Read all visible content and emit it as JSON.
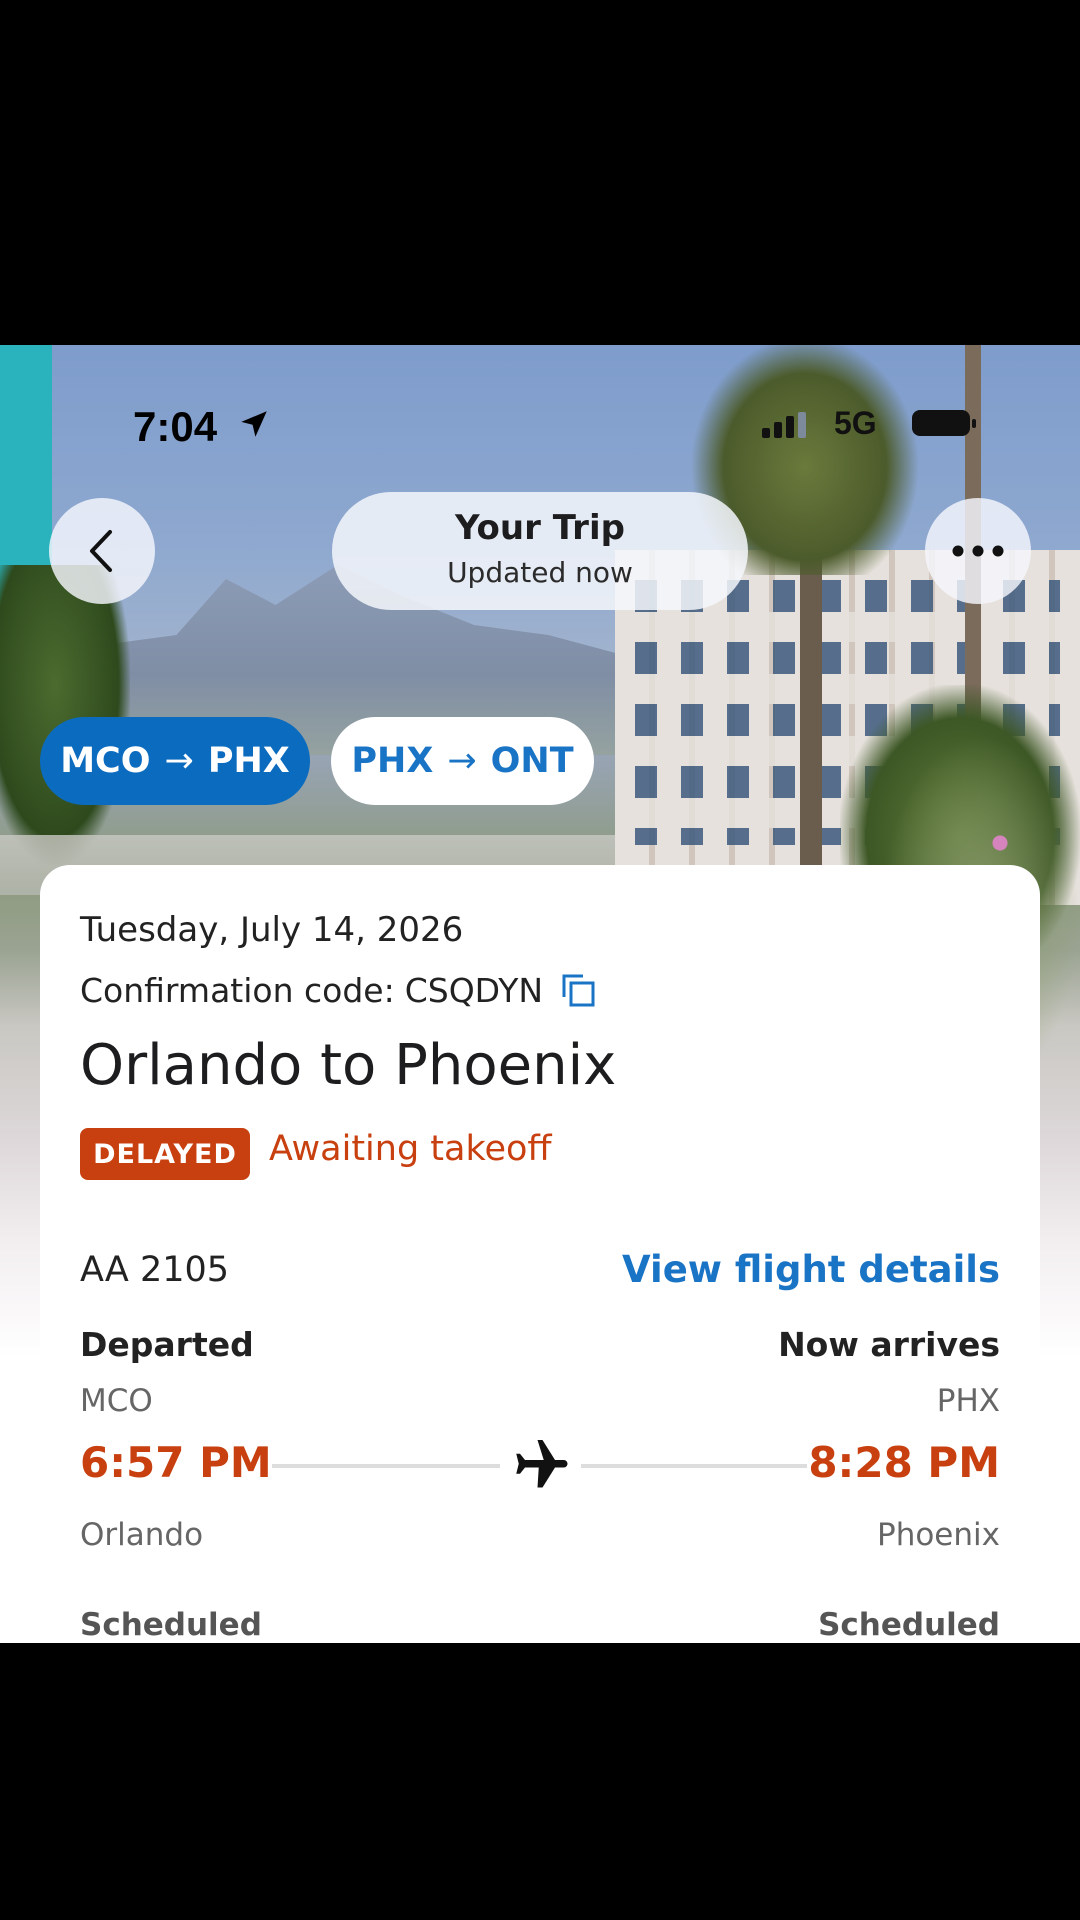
{
  "status_bar": {
    "time": "7:04",
    "network": "5G"
  },
  "header": {
    "title": "Your Trip",
    "subtitle": "Updated now"
  },
  "segments": [
    {
      "from": "MCO",
      "to": "PHX",
      "arrow": "→",
      "active": true
    },
    {
      "from": "PHX",
      "to": "ONT",
      "arrow": "→",
      "active": false
    }
  ],
  "trip": {
    "date": "Tuesday, July 14, 2026",
    "confirmation_label": "Confirmation code:",
    "confirmation_code": "CSQDYN",
    "route_title": "Orlando to Phoenix",
    "status_badge": "DELAYED",
    "status_text": "Awaiting takeoff",
    "flight_number": "AA 2105",
    "details_link": "View flight details",
    "depart": {
      "label": "Departed",
      "code": "MCO",
      "time": "6:57 PM",
      "city": "Orlando",
      "scheduled_label": "Scheduled"
    },
    "arrive": {
      "label": "Now arrives",
      "code": "PHX",
      "time": "8:28 PM",
      "city": "Phoenix",
      "scheduled_label": "Scheduled"
    }
  },
  "colors": {
    "accent_blue": "#0b6bbf",
    "link_blue": "#1a74c5",
    "delay_orange": "#c8400f"
  }
}
